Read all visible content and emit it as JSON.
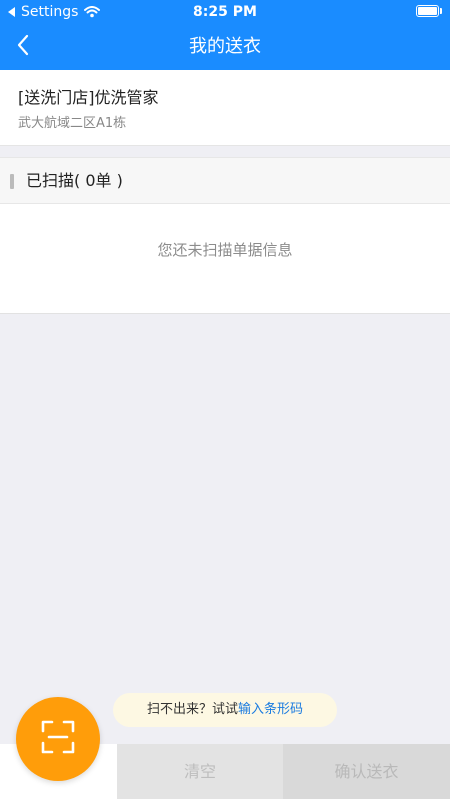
{
  "status_bar": {
    "carrier": "Settings",
    "time": "8:25 PM"
  },
  "nav": {
    "title": "我的送衣"
  },
  "store": {
    "name": "[送洗门店]优洗管家",
    "address": "武大航域二区A1栋"
  },
  "scanned": {
    "label": "已扫描( 0单 )"
  },
  "empty": {
    "message": "您还未扫描单据信息"
  },
  "hint": {
    "prefix": "扫不出来？试试",
    "link": "输入条形码"
  },
  "actions": {
    "clear": "清空",
    "confirm": "确认送衣"
  },
  "colors": {
    "primary": "#1a8cff",
    "accent_orange": "#ff9d0a",
    "link": "#1a7be0"
  },
  "icons": {
    "back": "chevron-left-icon",
    "scan": "scan-frame-icon",
    "wifi": "wifi-icon",
    "battery": "battery-icon"
  }
}
